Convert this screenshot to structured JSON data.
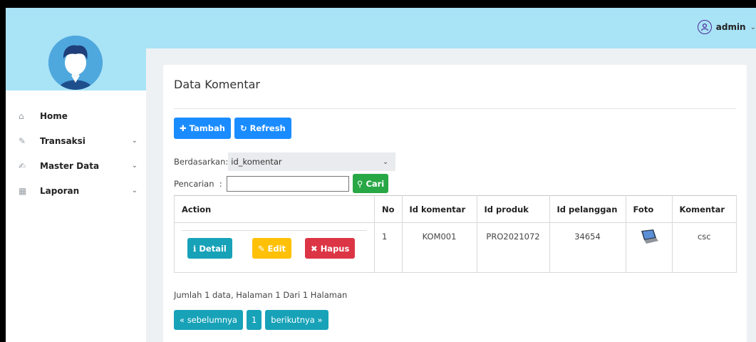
{
  "topbar": {
    "user_name": "admin",
    "user_icon": "user-circle-icon",
    "chevron": "chevron-down-icon"
  },
  "sidebar": {
    "items": [
      {
        "label": "Home",
        "icon": "home-icon",
        "has_chevron": false
      },
      {
        "label": "Transaksi",
        "icon": "pencil-icon",
        "has_chevron": true
      },
      {
        "label": "Master Data",
        "icon": "edit-icon",
        "has_chevron": true
      },
      {
        "label": "Laporan",
        "icon": "calendar-icon",
        "has_chevron": true
      }
    ]
  },
  "card": {
    "title": "Data Komentar",
    "buttons": {
      "add": "Tambah",
      "refresh": "Refresh"
    },
    "filter": {
      "by_label": "Berdasarkan:",
      "by_value": "id_komentar",
      "search_label": "Pencarian",
      "search_value": "",
      "search_button": "Cari"
    },
    "table": {
      "headers": [
        "Action",
        "No",
        "Id komentar",
        "Id produk",
        "Id pelanggan",
        "Foto",
        "Komentar"
      ],
      "rows": [
        {
          "no": "1",
          "id_komentar": "KOM001",
          "id_produk": "PRO2021072",
          "id_pelanggan": "34654",
          "foto": "laptop-thumbnail",
          "komentar": "csc"
        }
      ],
      "actions": {
        "detail": "Detail",
        "edit": "Edit",
        "delete": "Hapus"
      }
    },
    "info": "Jumlah 1 data, Halaman 1 Dari 1 Halaman",
    "pagination": {
      "prev": "« sebelumnya",
      "page": "1",
      "next": "berikutnya »"
    }
  },
  "colors": {
    "topbar": "#a9e3f6",
    "primary": "#1a8cff",
    "success": "#28a745",
    "info": "#17a2b8",
    "warning": "#ffc107",
    "danger": "#dc3545"
  }
}
